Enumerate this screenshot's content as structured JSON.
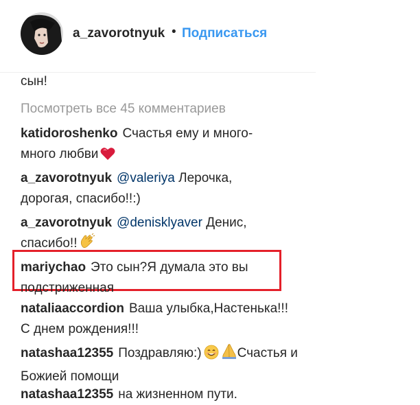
{
  "header": {
    "username": "a_zavorotnyuk",
    "separator": "•",
    "follow_label": "Подписаться"
  },
  "caption_tail": "сын!",
  "view_all": "Посмотреть все 45 комментариев",
  "comments": [
    {
      "user": "katidoroshenko",
      "text": "Счастья ему и много-много любви",
      "emoji": "heart-emoji"
    },
    {
      "user": "a_zavorotnyuk",
      "mention": "@valeriya",
      "text": "Лерочка, дорогая, спасибо!!:)"
    },
    {
      "user": "a_zavorotnyuk",
      "mention": "@denisklyaver",
      "text": "Денис, спасибо!!",
      "emoji": "clapping-hands-emoji"
    },
    {
      "user": "mariychao",
      "text": "Это сын?Я думала это вы подстриженная"
    },
    {
      "user": "nataliaaccordion",
      "text": "Ваша улыбка,Настенька!!! С днем рождения!!!"
    },
    {
      "user": "natashaa12355",
      "text_before": "Поздравляю:)",
      "text_after": "Счастья и Божией помощи",
      "emoji": [
        "smile-emoji",
        "praying-hands-emoji"
      ]
    },
    {
      "user": "natashaa12355",
      "text": "на жизненном пути."
    }
  ],
  "colors": {
    "link_blue": "#3897f0",
    "mention_blue": "#003569",
    "highlight_red": "#e4202a",
    "muted_gray": "#999999"
  }
}
